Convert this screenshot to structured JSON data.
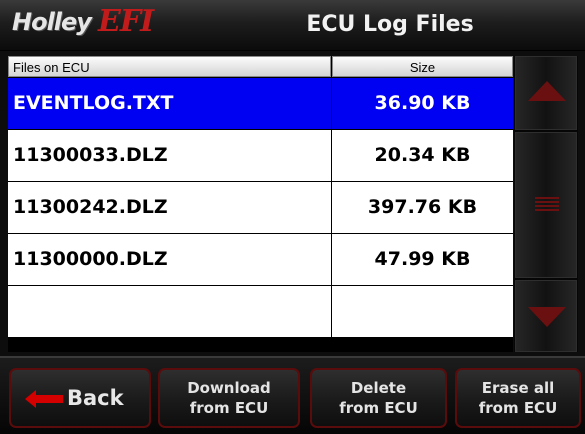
{
  "header": {
    "logo_brand": "Holley",
    "logo_product": "EFI",
    "title": "ECU Log Files"
  },
  "table": {
    "columns": {
      "name": "Files on ECU",
      "size": "Size"
    },
    "rows": [
      {
        "name": "EVENTLOG.TXT",
        "size": "36.90 KB",
        "selected": true
      },
      {
        "name": "11300033.DLZ",
        "size": "20.34 KB",
        "selected": false
      },
      {
        "name": "11300242.DLZ",
        "size": "397.76 KB",
        "selected": false
      },
      {
        "name": "11300000.DLZ",
        "size": "47.99 KB",
        "selected": false
      },
      {
        "name": "",
        "size": "",
        "selected": false
      }
    ]
  },
  "buttons": {
    "back": "Back",
    "download": [
      "Download",
      "from ECU"
    ],
    "delete": [
      "Delete",
      "from ECU"
    ],
    "erase": [
      "Erase all",
      "from ECU"
    ]
  },
  "colors": {
    "selection": "#0000f2",
    "accent": "#6a1010",
    "logo_efi": "#c21b1b"
  },
  "icons": {
    "scroll_up": "triangle-up-icon",
    "scroll_down": "triangle-down-icon",
    "scroll_grip": "grip-icon",
    "back": "arrow-left-icon"
  }
}
